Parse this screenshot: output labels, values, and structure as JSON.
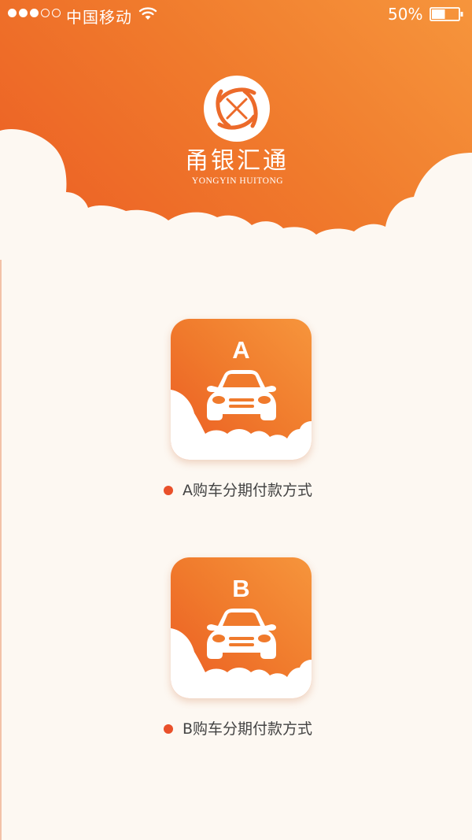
{
  "status_bar": {
    "carrier": "中国移动",
    "battery_percent": "50%",
    "signal_filled": 3,
    "signal_total": 5,
    "battery_level": 0.5,
    "icons": [
      "signal-dots-icon",
      "wifi-icon",
      "battery-icon"
    ]
  },
  "brand": {
    "name_cn": "甬银汇通",
    "name_en": "YONGYIN HUITONG",
    "logo_icon": "brand-logo-icon"
  },
  "options": [
    {
      "letter": "A",
      "label": "A购车分期付款方式",
      "icon": "car-icon"
    },
    {
      "letter": "B",
      "label": "B购车分期付款方式",
      "icon": "car-icon"
    }
  ],
  "colors": {
    "gradient_light": "#f6953c",
    "gradient_dark": "#eb5a23",
    "background": "#fdf8f2",
    "bullet": "#e9502a",
    "label_text": "#444444"
  }
}
